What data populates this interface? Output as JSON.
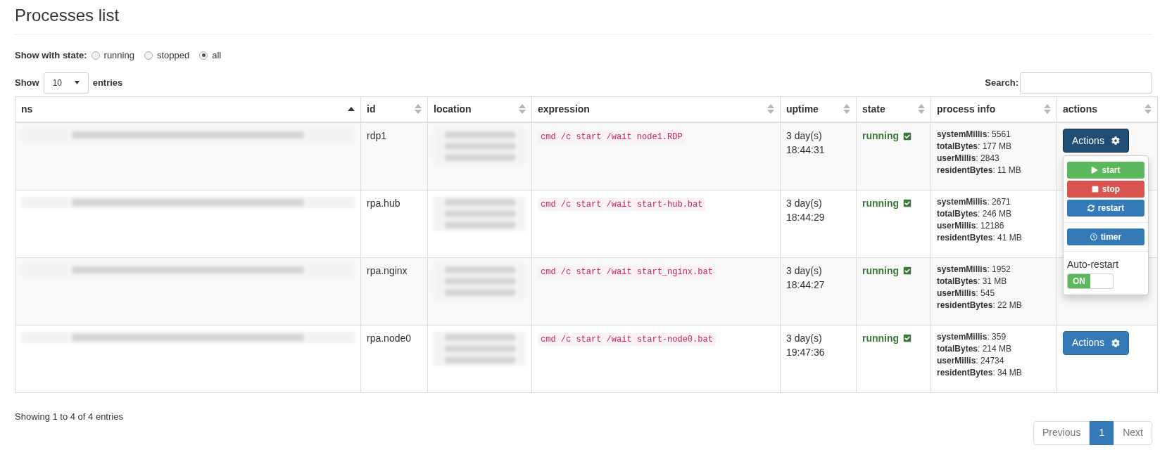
{
  "title": "Processes list",
  "state_filter": {
    "label": "Show with state:",
    "options": [
      {
        "label": "running",
        "selected": false
      },
      {
        "label": "stopped",
        "selected": false
      },
      {
        "label": "all",
        "selected": true
      }
    ]
  },
  "length": {
    "before": "Show",
    "value": "10",
    "after": "entries"
  },
  "search": {
    "label": "Search:"
  },
  "columns": [
    {
      "label": "ns",
      "sorted": true
    },
    {
      "label": "id",
      "sorted": false
    },
    {
      "label": "location",
      "sorted": false
    },
    {
      "label": "expression",
      "sorted": false
    },
    {
      "label": "uptime",
      "sorted": false
    },
    {
      "label": "state",
      "sorted": false
    },
    {
      "label": "process info",
      "sorted": false
    },
    {
      "label": "actions",
      "sorted": false
    }
  ],
  "rows": [
    {
      "id": "rdp1",
      "expression": "cmd /c start /wait node1.RDP",
      "uptime": [
        "3 day(s)",
        "18:44:31"
      ],
      "state": {
        "label": "running",
        "checked": true
      },
      "info": [
        "**systemMillis**: 5561",
        "**totalBytes**: 177 MB",
        "**userMillis**: 2843",
        "**residentBytes**: 11 MB"
      ],
      "actions": {
        "label": "Actions",
        "open": true
      }
    },
    {
      "id": "rpa.hub",
      "expression": "cmd /c start /wait start-hub.bat",
      "uptime": [
        "3 day(s)",
        "18:44:29"
      ],
      "state": {
        "label": "running",
        "checked": true
      },
      "info": [
        "**systemMillis**: 2671",
        "**totalBytes**: 246 MB",
        "**userMillis**: 12186",
        "**residentBytes**: 41 MB"
      ]
    },
    {
      "id": "rpa.nginx",
      "expression": "cmd /c start /wait start_nginx.bat",
      "uptime": [
        "3 day(s)",
        "18:44:27"
      ],
      "state": {
        "label": "running",
        "checked": true
      },
      "info": [
        "**systemMillis**: 1952",
        "**totalBytes**: 31 MB",
        "**userMillis**: 545",
        "**residentBytes**: 22 MB"
      ]
    },
    {
      "id": "rpa.node0",
      "expression": "cmd /c start /wait start-node0.bat",
      "uptime": [
        "3 day(s)",
        "19:47:36"
      ],
      "state": {
        "label": "running",
        "checked": true
      },
      "info": [
        "**systemMillis**: 359",
        "**totalBytes**: 214 MB",
        "**userMillis**: 24734",
        "**residentBytes**: 34 MB"
      ],
      "actions": {
        "label": "Actions",
        "open": false
      }
    }
  ],
  "actions_menu": {
    "groups": [
      [
        {
          "label": "start",
          "color": "#5cb85c"
        },
        {
          "label": "stop",
          "color": "#d9534f"
        },
        {
          "label": "restart",
          "color": "#337ab7"
        }
      ],
      [
        {
          "label": "timer",
          "color": "#337ab7"
        }
      ]
    ],
    "auto_restart": {
      "label": "Auto-restart",
      "on": true,
      "on_label": "ON"
    }
  },
  "info_text": "Showing 1 to 4 of 4 entries",
  "pagination": {
    "previous": {
      "label": "Previous",
      "disabled": true
    },
    "pages": [
      {
        "label": "1",
        "selected": true
      }
    ],
    "next": {
      "label": "Next",
      "disabled": true
    }
  }
}
